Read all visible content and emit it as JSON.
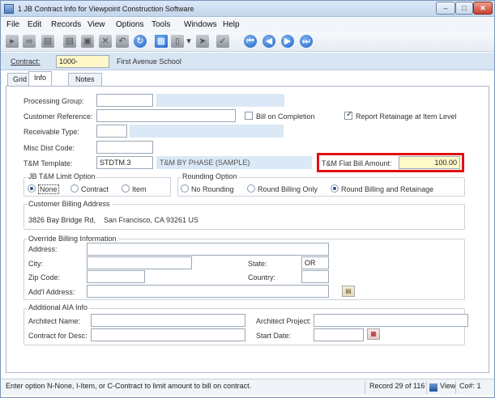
{
  "window": {
    "title": "1 JB Contract Info for Viewpoint Construction Software",
    "min": "–",
    "max": "□",
    "close": "✕"
  },
  "menu": [
    "File",
    "Edit",
    "Records",
    "View",
    "Options",
    "Tools",
    "Windows",
    "Help"
  ],
  "toolbar": {
    "icons": [
      "open-icon",
      "search-records-icon",
      "print-icon",
      "print2-icon",
      "save-icon",
      "delete-icon",
      "undo-icon",
      "refresh-icon",
      "calculator-icon",
      "attachment-icon",
      "dropdown-arrow-icon",
      "spellcheck-icon",
      "first-record-icon",
      "prev-record-icon",
      "next-record-icon",
      "last-record-icon"
    ]
  },
  "contract": {
    "label": "Contract:",
    "value": "1000-",
    "description": "First Avenue School"
  },
  "tabs": [
    "Grid",
    "Info",
    "Notes"
  ],
  "form": {
    "processing_group": {
      "label": "Processing Group:",
      "value": "",
      "desc": ""
    },
    "customer_reference": {
      "label": "Customer Reference:",
      "value": ""
    },
    "bill_on_completion": {
      "label": "Bill on Completion",
      "checked": false
    },
    "report_retainage": {
      "label": "Report Retainage at Item Level",
      "checked": true
    },
    "receivable_type": {
      "label": "Receivable Type:",
      "value": "",
      "desc": ""
    },
    "misc_dist_code": {
      "label": "Misc Dist Code:",
      "value": ""
    },
    "tm_template": {
      "label": "T&M Template:",
      "value": "STDTM.3",
      "desc": "T&M BY PHASE (SAMPLE)"
    },
    "tm_flat_bill": {
      "label": "T&M Flat Bill Amount:",
      "value": "100.00"
    }
  },
  "limit_option": {
    "title": "JB T&M Limit Option",
    "options": [
      "None",
      "Contract",
      "Item"
    ],
    "selected": "None"
  },
  "rounding_option": {
    "title": "Rounding Option",
    "options": [
      "No Rounding",
      "Round Billing Only",
      "Round Billing and Retainage"
    ],
    "selected": "Round Billing and Retainage"
  },
  "customer_billing": {
    "title": "Customer Billing Address",
    "address": "3826 Bay Bridge Rd,",
    "city_state_zip": "San Francisco,  CA  93261  US"
  },
  "override_billing": {
    "title": "Override Billing Information",
    "address_label": "Address:",
    "city_label": "City:",
    "state_label": "State:",
    "state_value": "OR",
    "zip_label": "Zip Code:",
    "country_label": "Country:",
    "addl_label": "Add'l Address:"
  },
  "aia": {
    "title": "Additional AIA Info",
    "architect_name_label": "Architect Name:",
    "architect_project_label": "Architect Project:",
    "contract_desc_label": "Contract for Desc:",
    "start_date_label": "Start Date:"
  },
  "status": {
    "message": "Enter option N-None, I-Item, or C-Contract to limit amount to bill on contract.",
    "record": "Record 29 of 116",
    "view": "View",
    "company": "Co#: 1"
  }
}
